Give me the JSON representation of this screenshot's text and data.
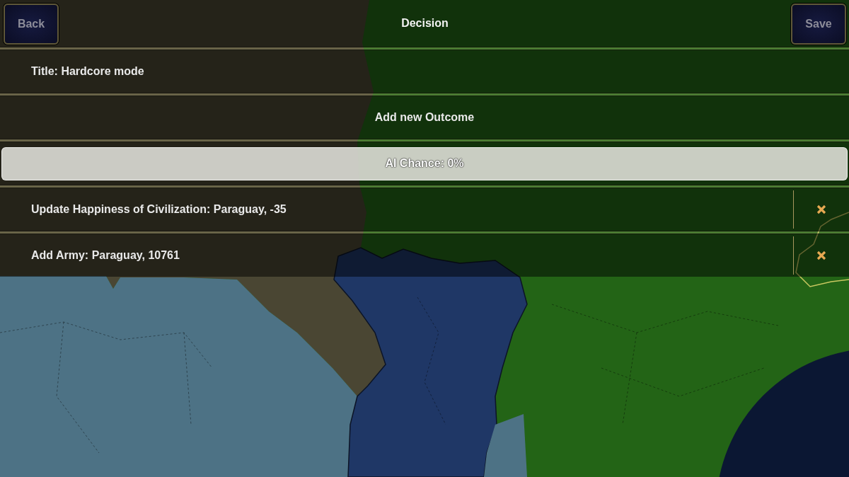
{
  "top_bar": {
    "back_button": "Back",
    "title": "Decision",
    "save_button": "Save"
  },
  "rows": [
    {
      "kind": "text",
      "label": "Title: Hardcore mode"
    },
    {
      "kind": "action",
      "label": "Add new Outcome"
    },
    {
      "kind": "button",
      "label": "AI Chance: 0%"
    },
    {
      "kind": "removable",
      "label": "Update Happiness of Civilization: Paraguay, -35"
    },
    {
      "kind": "removable",
      "label": "Add Army: Paraguay, 10761"
    }
  ]
}
